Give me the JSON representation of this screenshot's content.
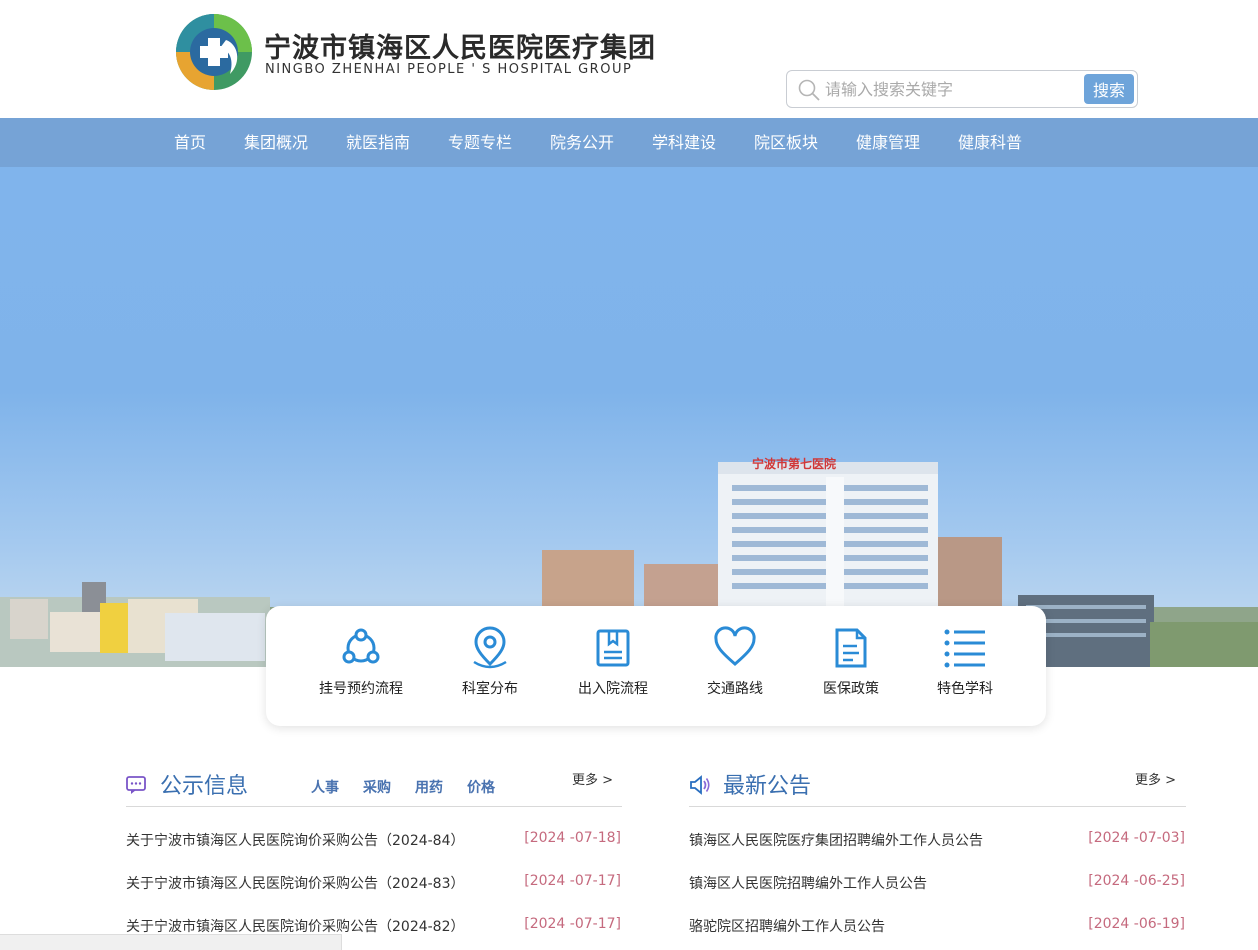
{
  "header": {
    "brand_cn": "宁波市镇海区人民医院医疗集团",
    "brand_en": "NINGBO ZHENHAI PEOPLE ' S HOSPITAL GROUP",
    "search_placeholder": "请输入搜索关键字",
    "search_button": "搜索"
  },
  "nav": [
    "首页",
    "集团概况",
    "就医指南",
    "专题专栏",
    "院务公开",
    "学科建设",
    "院区板块",
    "健康管理",
    "健康科普"
  ],
  "hero": {
    "building_sign": "宁波市第七医院"
  },
  "quick_links": [
    {
      "label": "挂号预约流程",
      "icon": "share-nodes-icon"
    },
    {
      "label": "科室分布",
      "icon": "map-pin-icon"
    },
    {
      "label": "出入院流程",
      "icon": "book-icon"
    },
    {
      "label": "交通路线",
      "icon": "heart-icon"
    },
    {
      "label": "医保政策",
      "icon": "document-icon"
    },
    {
      "label": "特色学科",
      "icon": "list-icon"
    }
  ],
  "notices": {
    "title": "公示信息",
    "tabs": [
      "人事",
      "采购",
      "用药",
      "价格"
    ],
    "more": "更多 >",
    "items": [
      {
        "text": "关于宁波市镇海区人民医院询价采购公告（2024-84）",
        "date": "[2024 -07-18]"
      },
      {
        "text": "关于宁波市镇海区人民医院询价采购公告（2024-83）",
        "date": "[2024 -07-17]"
      },
      {
        "text": "关于宁波市镇海区人民医院询价采购公告（2024-82）",
        "date": "[2024 -07-17]"
      }
    ]
  },
  "announcements": {
    "title": "最新公告",
    "more": "更多 >",
    "items": [
      {
        "text": "镇海区人民医院医疗集团招聘编外工作人员公告",
        "date": "[2024 -07-03]"
      },
      {
        "text": "镇海区人民医院招聘编外工作人员公告",
        "date": "[2024 -06-25]"
      },
      {
        "text": "骆驼院区招聘编外工作人员公告",
        "date": "[2024 -06-19]"
      }
    ]
  },
  "colors": {
    "nav_bg": "#76a3d6",
    "accent": "#3a6fb0",
    "date": "#c56a7e",
    "search_button": "#6ea4da"
  }
}
